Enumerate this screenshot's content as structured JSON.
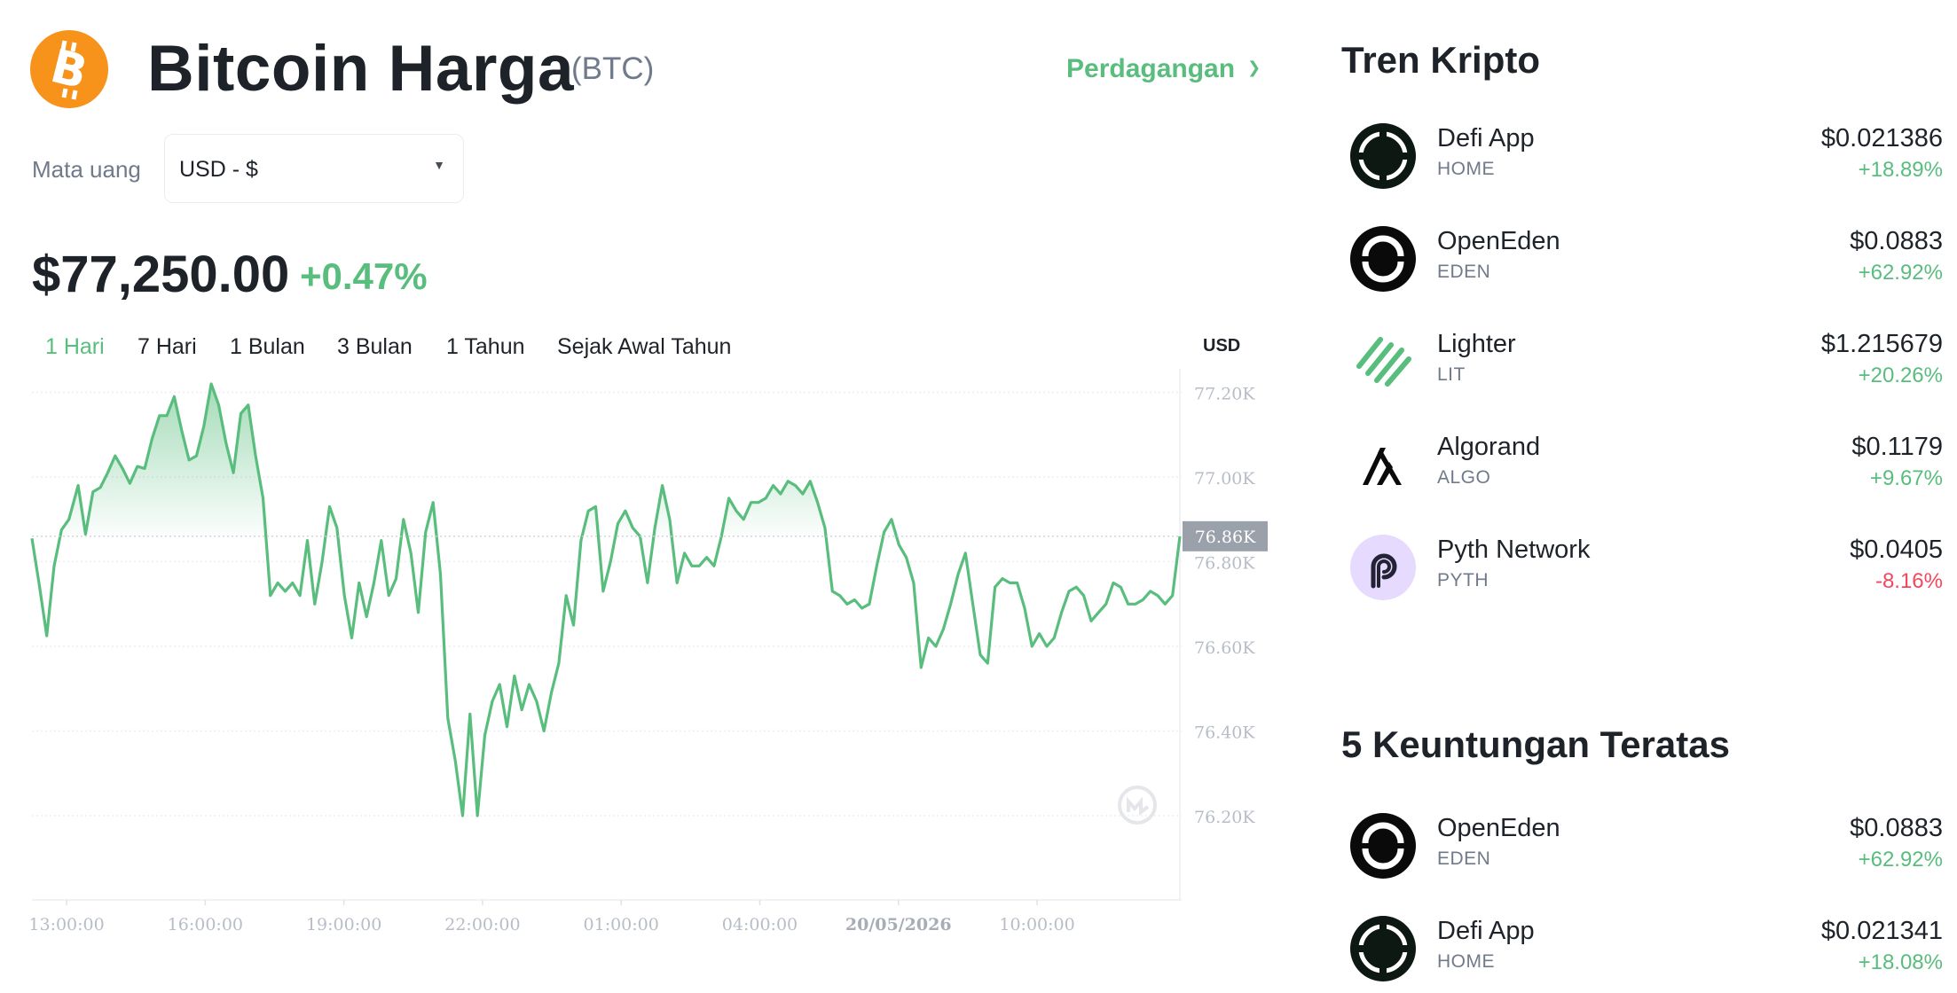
{
  "header": {
    "title": "Bitcoin Harga",
    "ticker": "(BTC)",
    "trade_menu": "Perdagangan",
    "currency_label": "Mata uang",
    "currency_value": "USD - $",
    "price": "$77,250.00",
    "change": "+0.47%"
  },
  "colors": {
    "accent_green": "#58bd7d",
    "negative_red": "#f6465d",
    "bitcoin_orange": "#f7931a"
  },
  "range_tabs": [
    {
      "label": "1 Hari",
      "active": true
    },
    {
      "label": "7 Hari",
      "active": false
    },
    {
      "label": "1 Bulan",
      "active": false
    },
    {
      "label": "3 Bulan",
      "active": false
    },
    {
      "label": "1 Tahun",
      "active": false
    },
    {
      "label": "Sejak Awal Tahun",
      "active": false
    }
  ],
  "chart_unit": "USD",
  "chart_data": {
    "type": "line",
    "grid": true,
    "ylim": [
      76000,
      77300
    ],
    "yticks": [
      {
        "value": 76200,
        "label": "76.20K"
      },
      {
        "value": 76400,
        "label": "76.40K"
      },
      {
        "value": 76600,
        "label": "76.60K"
      },
      {
        "value": 76800,
        "label": "76.80K"
      },
      {
        "value": 77000,
        "label": "77.00K"
      },
      {
        "value": 77200,
        "label": "77.20K"
      }
    ],
    "xticks": [
      {
        "t": 0.75,
        "label": "13:00:00",
        "bold": false
      },
      {
        "t": 3.75,
        "label": "16:00:00",
        "bold": false
      },
      {
        "t": 6.75,
        "label": "19:00:00",
        "bold": false
      },
      {
        "t": 9.75,
        "label": "22:00:00",
        "bold": false
      },
      {
        "t": 12.75,
        "label": "01:00:00",
        "bold": false
      },
      {
        "t": 15.75,
        "label": "04:00:00",
        "bold": false
      },
      {
        "t": 18.75,
        "label": "20/05/2026",
        "bold": true
      },
      {
        "t": 21.75,
        "label": "10:00:00",
        "bold": false
      }
    ],
    "current": {
      "value": 76860,
      "label": "76.86K"
    },
    "series": [
      {
        "values": [
          [
            0.0,
            76855
          ],
          [
            0.16,
            76745
          ],
          [
            0.32,
            76625
          ],
          [
            0.48,
            76790
          ],
          [
            0.64,
            76875
          ],
          [
            0.8,
            76900
          ],
          [
            1.0,
            76980
          ],
          [
            1.16,
            76865
          ],
          [
            1.32,
            76965
          ],
          [
            1.48,
            76975
          ],
          [
            1.64,
            77010
          ],
          [
            1.8,
            77050
          ],
          [
            1.96,
            77020
          ],
          [
            2.12,
            76985
          ],
          [
            2.28,
            77025
          ],
          [
            2.44,
            77020
          ],
          [
            2.6,
            77090
          ],
          [
            2.76,
            77145
          ],
          [
            2.92,
            77145
          ],
          [
            3.08,
            77190
          ],
          [
            3.24,
            77110
          ],
          [
            3.4,
            77040
          ],
          [
            3.56,
            77050
          ],
          [
            3.72,
            77120
          ],
          [
            3.88,
            77220
          ],
          [
            4.04,
            77170
          ],
          [
            4.2,
            77080
          ],
          [
            4.36,
            77010
          ],
          [
            4.52,
            77150
          ],
          [
            4.68,
            77170
          ],
          [
            4.84,
            77050
          ],
          [
            5.0,
            76950
          ],
          [
            5.16,
            76720
          ],
          [
            5.32,
            76750
          ],
          [
            5.48,
            76730
          ],
          [
            5.64,
            76750
          ],
          [
            5.8,
            76720
          ],
          [
            5.96,
            76850
          ],
          [
            6.12,
            76700
          ],
          [
            6.28,
            76800
          ],
          [
            6.44,
            76930
          ],
          [
            6.6,
            76880
          ],
          [
            6.76,
            76720
          ],
          [
            6.92,
            76620
          ],
          [
            7.08,
            76750
          ],
          [
            7.24,
            76670
          ],
          [
            7.4,
            76750
          ],
          [
            7.56,
            76850
          ],
          [
            7.72,
            76720
          ],
          [
            7.88,
            76760
          ],
          [
            8.04,
            76900
          ],
          [
            8.2,
            76820
          ],
          [
            8.36,
            76680
          ],
          [
            8.52,
            76870
          ],
          [
            8.68,
            76940
          ],
          [
            8.84,
            76770
          ],
          [
            9.0,
            76430
          ],
          [
            9.16,
            76330
          ],
          [
            9.32,
            76200
          ],
          [
            9.48,
            76440
          ],
          [
            9.64,
            76200
          ],
          [
            9.8,
            76390
          ],
          [
            9.96,
            76470
          ],
          [
            10.12,
            76510
          ],
          [
            10.28,
            76410
          ],
          [
            10.44,
            76530
          ],
          [
            10.6,
            76450
          ],
          [
            10.76,
            76510
          ],
          [
            10.92,
            76470
          ],
          [
            11.08,
            76400
          ],
          [
            11.24,
            76490
          ],
          [
            11.4,
            76560
          ],
          [
            11.56,
            76720
          ],
          [
            11.72,
            76650
          ],
          [
            11.88,
            76850
          ],
          [
            12.04,
            76920
          ],
          [
            12.2,
            76930
          ],
          [
            12.36,
            76730
          ],
          [
            12.52,
            76800
          ],
          [
            12.68,
            76890
          ],
          [
            12.84,
            76920
          ],
          [
            13.0,
            76880
          ],
          [
            13.16,
            76860
          ],
          [
            13.32,
            76750
          ],
          [
            13.48,
            76880
          ],
          [
            13.64,
            76980
          ],
          [
            13.8,
            76900
          ],
          [
            13.96,
            76750
          ],
          [
            14.12,
            76820
          ],
          [
            14.28,
            76790
          ],
          [
            14.44,
            76790
          ],
          [
            14.6,
            76810
          ],
          [
            14.76,
            76790
          ],
          [
            14.92,
            76860
          ],
          [
            15.08,
            76950
          ],
          [
            15.24,
            76920
          ],
          [
            15.4,
            76900
          ],
          [
            15.56,
            76940
          ],
          [
            15.72,
            76940
          ],
          [
            15.88,
            76950
          ],
          [
            16.04,
            76980
          ],
          [
            16.2,
            76960
          ],
          [
            16.36,
            76990
          ],
          [
            16.52,
            76980
          ],
          [
            16.68,
            76960
          ],
          [
            16.84,
            76990
          ],
          [
            17.0,
            76940
          ],
          [
            17.16,
            76880
          ],
          [
            17.32,
            76730
          ],
          [
            17.48,
            76720
          ],
          [
            17.64,
            76700
          ],
          [
            17.8,
            76710
          ],
          [
            17.96,
            76690
          ],
          [
            18.12,
            76700
          ],
          [
            18.28,
            76790
          ],
          [
            18.44,
            76870
          ],
          [
            18.6,
            76900
          ],
          [
            18.76,
            76840
          ],
          [
            18.92,
            76810
          ],
          [
            19.08,
            76750
          ],
          [
            19.24,
            76550
          ],
          [
            19.4,
            76620
          ],
          [
            19.56,
            76600
          ],
          [
            19.72,
            76640
          ],
          [
            19.88,
            76700
          ],
          [
            20.04,
            76770
          ],
          [
            20.2,
            76820
          ],
          [
            20.36,
            76700
          ],
          [
            20.52,
            76580
          ],
          [
            20.68,
            76560
          ],
          [
            20.84,
            76740
          ],
          [
            21.0,
            76760
          ],
          [
            21.16,
            76750
          ],
          [
            21.32,
            76750
          ],
          [
            21.48,
            76690
          ],
          [
            21.64,
            76600
          ],
          [
            21.8,
            76630
          ],
          [
            21.96,
            76600
          ],
          [
            22.12,
            76620
          ],
          [
            22.28,
            76680
          ],
          [
            22.44,
            76730
          ],
          [
            22.6,
            76740
          ],
          [
            22.76,
            76720
          ],
          [
            22.92,
            76660
          ],
          [
            23.08,
            76680
          ],
          [
            23.24,
            76700
          ],
          [
            23.4,
            76750
          ],
          [
            23.56,
            76740
          ],
          [
            23.72,
            76700
          ],
          [
            23.88,
            76700
          ],
          [
            24.04,
            76710
          ],
          [
            24.2,
            76730
          ],
          [
            24.36,
            76720
          ],
          [
            24.52,
            76700
          ],
          [
            24.68,
            76720
          ],
          [
            24.84,
            76860
          ]
        ]
      }
    ]
  },
  "sidebar": {
    "trending_title": "Tren Kripto",
    "trending": [
      {
        "name": "Defi App",
        "symbol": "HOME",
        "price": "$0.021386",
        "change": "+18.89%",
        "direction": "up",
        "icon": "defi-app-icon"
      },
      {
        "name": "OpenEden",
        "symbol": "EDEN",
        "price": "$0.0883",
        "change": "+62.92%",
        "direction": "up",
        "icon": "openeden-icon"
      },
      {
        "name": "Lighter",
        "symbol": "LIT",
        "price": "$1.215679",
        "change": "+20.26%",
        "direction": "up",
        "icon": "lighter-icon"
      },
      {
        "name": "Algorand",
        "symbol": "ALGO",
        "price": "$0.1179",
        "change": "+9.67%",
        "direction": "up",
        "icon": "algorand-icon"
      },
      {
        "name": "Pyth Network",
        "symbol": "PYTH",
        "price": "$0.0405",
        "change": "-8.16%",
        "direction": "down",
        "icon": "pyth-network-icon"
      }
    ],
    "gainers_title": "5 Keuntungan Teratas",
    "gainers": [
      {
        "name": "OpenEden",
        "symbol": "EDEN",
        "price": "$0.0883",
        "change": "+62.92%",
        "direction": "up",
        "icon": "openeden-icon"
      },
      {
        "name": "Defi App",
        "symbol": "HOME",
        "price": "$0.021341",
        "change": "+18.08%",
        "direction": "up",
        "icon": "defi-app-icon"
      }
    ]
  }
}
